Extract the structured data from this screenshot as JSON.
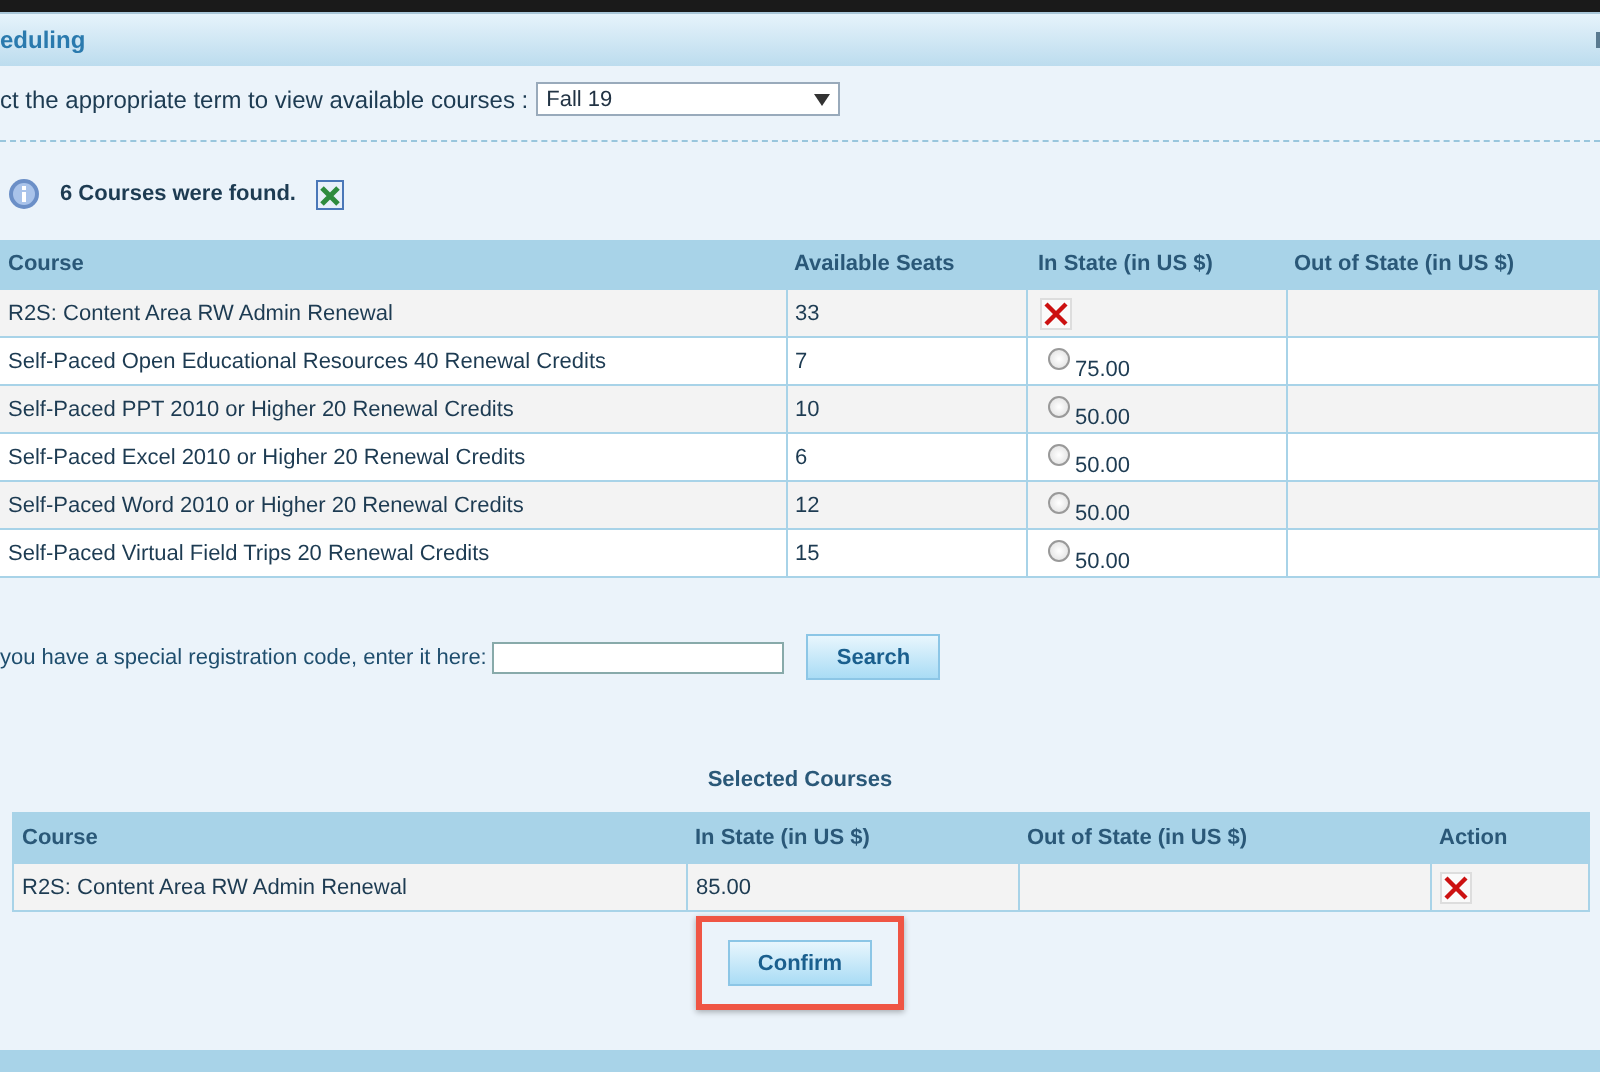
{
  "header": {
    "title": "eduling"
  },
  "term": {
    "label": "ct the appropriate term to view available courses :",
    "value": "Fall 19"
  },
  "result": {
    "message": "6 Courses were found."
  },
  "courses": {
    "columns": [
      "Course",
      "Available Seats",
      "In State (in US $)",
      "Out of State (in US $)"
    ],
    "rows": [
      {
        "course": "R2S: Content Area RW Admin Renewal",
        "seats": "33",
        "kind": "remove"
      },
      {
        "course": "Self-Paced Open Educational Resources 40 Renewal Credits",
        "seats": "7",
        "kind": "option",
        "price": "75.00",
        "selected": false
      },
      {
        "course": "Self-Paced PPT 2010 or Higher 20 Renewal Credits",
        "seats": "10",
        "kind": "option",
        "price": "50.00",
        "selected": false
      },
      {
        "course": "Self-Paced Excel 2010 or Higher 20 Renewal Credits",
        "seats": "6",
        "kind": "option",
        "price": "50.00",
        "selected": false
      },
      {
        "course": "Self-Paced Word 2010 or Higher 20 Renewal Credits",
        "seats": "12",
        "kind": "option",
        "price": "50.00",
        "selected": false
      },
      {
        "course": "Self-Paced Virtual Field Trips 20 Renewal Credits",
        "seats": "15",
        "kind": "option",
        "price": "50.00",
        "selected": false
      }
    ]
  },
  "code": {
    "label": "you have a special registration code, enter it here:",
    "button": "Search"
  },
  "selected_courses": {
    "title": "Selected Courses",
    "columns": [
      "Course",
      "In State (in US $)",
      "Out of State (in US $)",
      "Action"
    ],
    "rows": [
      {
        "course": "R2S: Content Area RW Admin Renewal",
        "in_state": "85.00"
      }
    ]
  },
  "confirm": {
    "label": "Confirm",
    "highlighted": true
  }
}
